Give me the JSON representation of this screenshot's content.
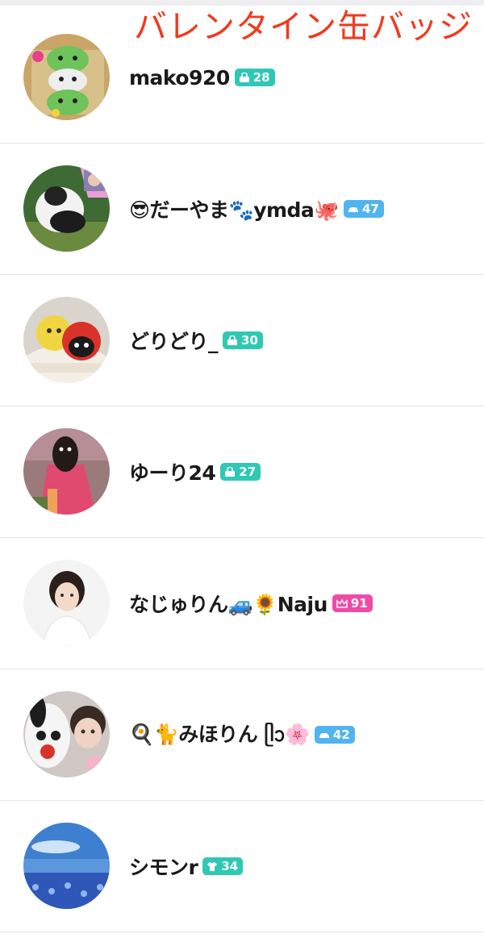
{
  "overlay_text": "バレンタイン缶バッジ",
  "users": [
    {
      "name": "mako920",
      "badge": {
        "icon": "bag-icon",
        "value": "28",
        "color": "#2fc8b4"
      }
    },
    {
      "name": "😎だーやま🐾ymda🐙",
      "badge": {
        "icon": "car-icon",
        "value": "47",
        "color": "#50b4f0"
      }
    },
    {
      "name": "どりどり_",
      "badge": {
        "icon": "bag-icon",
        "value": "30",
        "color": "#2fc8b4"
      }
    },
    {
      "name": "ゆーり24",
      "badge": {
        "icon": "bag-icon",
        "value": "27",
        "color": "#2fc8b4"
      }
    },
    {
      "name": "なじゅりん🚙🌻Naju",
      "badge": {
        "icon": "crown-icon",
        "value": "91",
        "color": "#f04aa8"
      }
    },
    {
      "name": "🍳🐈みほりん ᥫᩣ🌸",
      "badge": {
        "icon": "car-icon",
        "value": "42",
        "color": "#50b4f0"
      }
    },
    {
      "name": "シモンr",
      "badge": {
        "icon": "shirt-icon",
        "value": "34",
        "color": "#2fc8b4"
      }
    }
  ]
}
